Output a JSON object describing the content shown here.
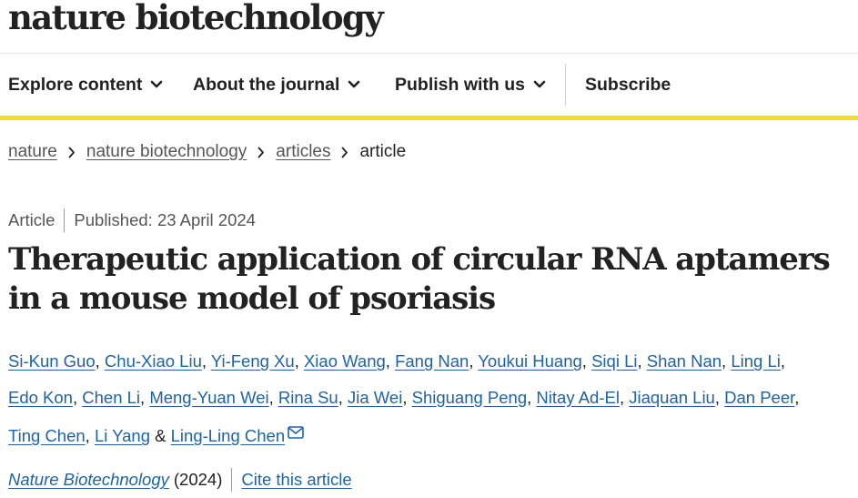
{
  "site": {
    "brand": "nature biotechnology"
  },
  "nav": {
    "items": [
      {
        "label": "Explore content"
      },
      {
        "label": "About the journal"
      },
      {
        "label": "Publish with us"
      }
    ],
    "subscribe": "Subscribe"
  },
  "breadcrumb": [
    "nature",
    "nature biotechnology",
    "articles",
    "article"
  ],
  "article": {
    "type": "Article",
    "published": "Published: 23 April 2024",
    "title": "Therapeutic application of circular RNA aptamers in a mouse model of psoriasis",
    "authors": [
      "Si-Kun Guo",
      "Chu-Xiao Liu",
      "Yi-Feng Xu",
      "Xiao Wang",
      "Fang Nan",
      "Youkui Huang",
      "Siqi Li",
      "Shan Nan",
      "Ling Li",
      "Edo Kon",
      "Chen Li",
      "Meng-Yuan Wei",
      "Rina Su",
      "Jia Wei",
      "Shiguang Peng",
      "Nitay Ad-El",
      "Jiaquan Liu",
      "Dan Peer",
      "Ting Chen",
      "Li Yang",
      "Ling-Ling Chen"
    ],
    "author_join": "&",
    "journal": "Nature Biotechnology",
    "year": "(2024)",
    "cite_label": "Cite this article"
  },
  "colors": {
    "accent_yellow": "#f2de1f",
    "link_blue": "#1e63a8",
    "text": "#222222",
    "muted": "#555555"
  },
  "icons": {
    "chevron": "chevron-down-icon",
    "separator": "chevron-right-icon",
    "mail": "envelope-icon"
  }
}
